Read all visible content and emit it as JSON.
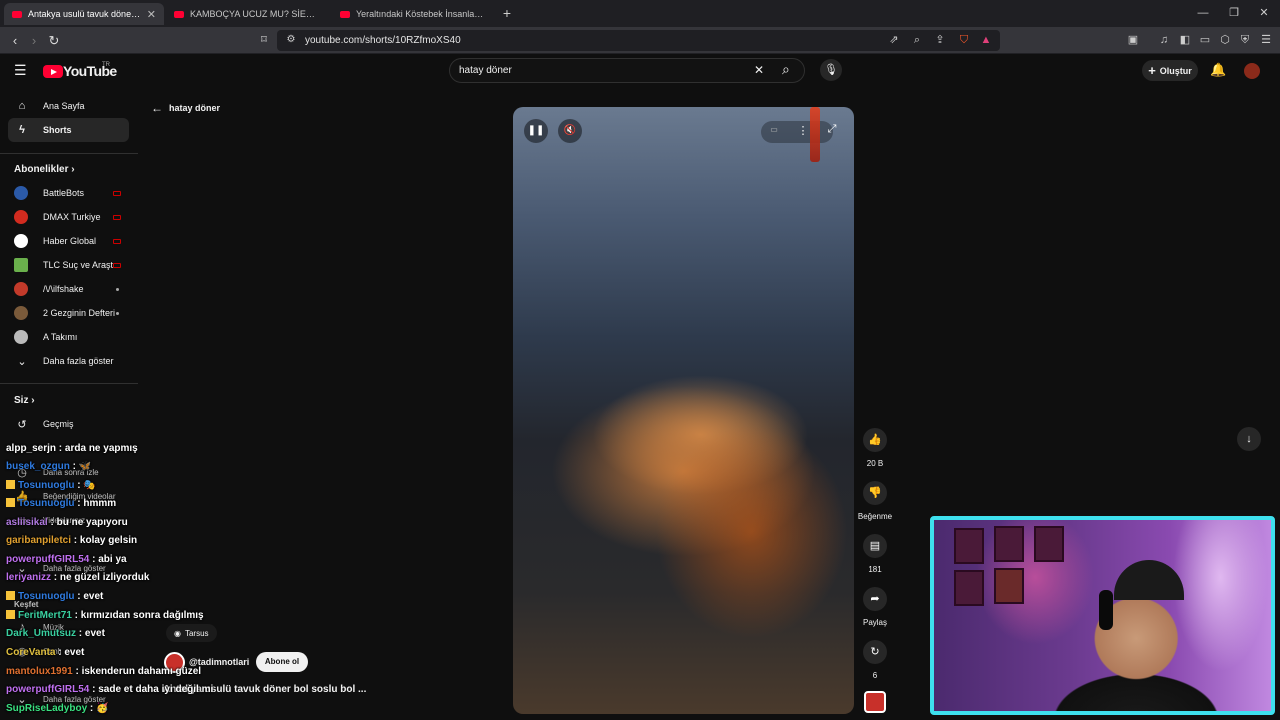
{
  "browser": {
    "tabs": [
      {
        "title": "Antakya usulü tavuk döner bol s",
        "active": true
      },
      {
        "title": "KAMBOÇYA UCUZ MU? SİEM REAP'T",
        "active": false
      },
      {
        "title": "Yeraltındaki Köstebek İnsanlar'a Yolcu",
        "active": false
      }
    ],
    "new_tab": "+",
    "window": {
      "minimize": "—",
      "maximize": "❐",
      "close": "✕"
    },
    "url": "youtube.com/shorts/10RZfmoXS40"
  },
  "header": {
    "logo": "YouTube",
    "logo_region": "TR",
    "search_value": "hatay döner",
    "create_label": "Oluştur"
  },
  "sidebar": {
    "items": [
      {
        "label": "Ana Sayfa"
      },
      {
        "label": "Shorts"
      }
    ],
    "subscriptions_heading": "Abonelikler",
    "subscriptions": [
      {
        "label": "BattleBots",
        "color": "#2b5aa8"
      },
      {
        "label": "DMAX Turkiye",
        "color": "#d22b1f"
      },
      {
        "label": "Haber Global",
        "color": "#ffffff"
      },
      {
        "label": "TLC Suç ve Araşt...",
        "color": "#6ab04c"
      },
      {
        "label": "/\\/\\ilfshake",
        "color": "#c23a2a"
      },
      {
        "label": "2 Gezginin Defteri",
        "color": "#7a5a3a"
      },
      {
        "label": "A Takımı",
        "color": "#bbbbbb"
      }
    ],
    "show_more": "Daha fazla göster",
    "you_heading": "Siz",
    "you_items": [
      {
        "label": "Geçmiş"
      },
      {
        "label": "Daha sonra izle"
      },
      {
        "label": "Beğendiğim videolar"
      },
      {
        "label": "Videolarınız"
      },
      {
        "label": "Daha fazla göster"
      }
    ],
    "explore_heading": "Keşfet",
    "explore_items": [
      {
        "label": "Müzik"
      },
      {
        "label": "Canlı"
      },
      {
        "label": "Daha fazla göster"
      }
    ]
  },
  "back_label": "hatay döner",
  "short": {
    "author": "@tadimnotlari",
    "subscribe": "Abone ol",
    "location": "Tarsus",
    "title": "Antakya usulü tavuk döner bol soslu bol ...",
    "likes": "20 B",
    "dislike_label": "Beğenme",
    "comments": "181",
    "share_label": "Paylaş",
    "remix_count": "6"
  },
  "chat": [
    {
      "user": "alpp_serjn",
      "user_color": "#ffffff",
      "text": "arda ne yapmış"
    },
    {
      "user": "busek_ozgun",
      "user_color": "#2f7be0",
      "text": "🦋"
    },
    {
      "user": "Tosunuoglu",
      "user_color": "#2f7be0",
      "text": "🎭"
    },
    {
      "user": "Tosunuoglu",
      "user_color": "#2f7be0",
      "text": "hmmm"
    },
    {
      "user": "asliisikal",
      "user_color": "#b07ae0",
      "text": "bu ne yapıyoru"
    },
    {
      "user": "garibanpiletci",
      "user_color": "#e0a030",
      "text": "kolay gelsin"
    },
    {
      "user": "powerpuffGIRL54",
      "user_color": "#c070f0",
      "text": "abi ya"
    },
    {
      "user": "leriyanizz",
      "user_color": "#c070f0",
      "text": "ne güzel izliyorduk"
    },
    {
      "user": "Tosunuoglu",
      "user_color": "#2f7be0",
      "text": "evet"
    },
    {
      "user": "FeritMert71",
      "user_color": "#3ad0a0",
      "text": "kırmızıdan sonra dağılmış"
    },
    {
      "user": "Dark_Umutsuz",
      "user_color": "#3ad0a0",
      "text": "evet"
    },
    {
      "user": "CoreVanta",
      "user_color": "#e0c040",
      "text": "evet"
    },
    {
      "user": "mantolux1991",
      "user_color": "#e07030",
      "text": "iskenderun dahamı güzel"
    },
    {
      "user": "powerpuffGIRL54",
      "user_color": "#c070f0",
      "text": "sade et daha iyi değil mi"
    },
    {
      "user": "SupRiseLadyboy",
      "user_color": "#3ae080",
      "text": "🥳"
    }
  ]
}
